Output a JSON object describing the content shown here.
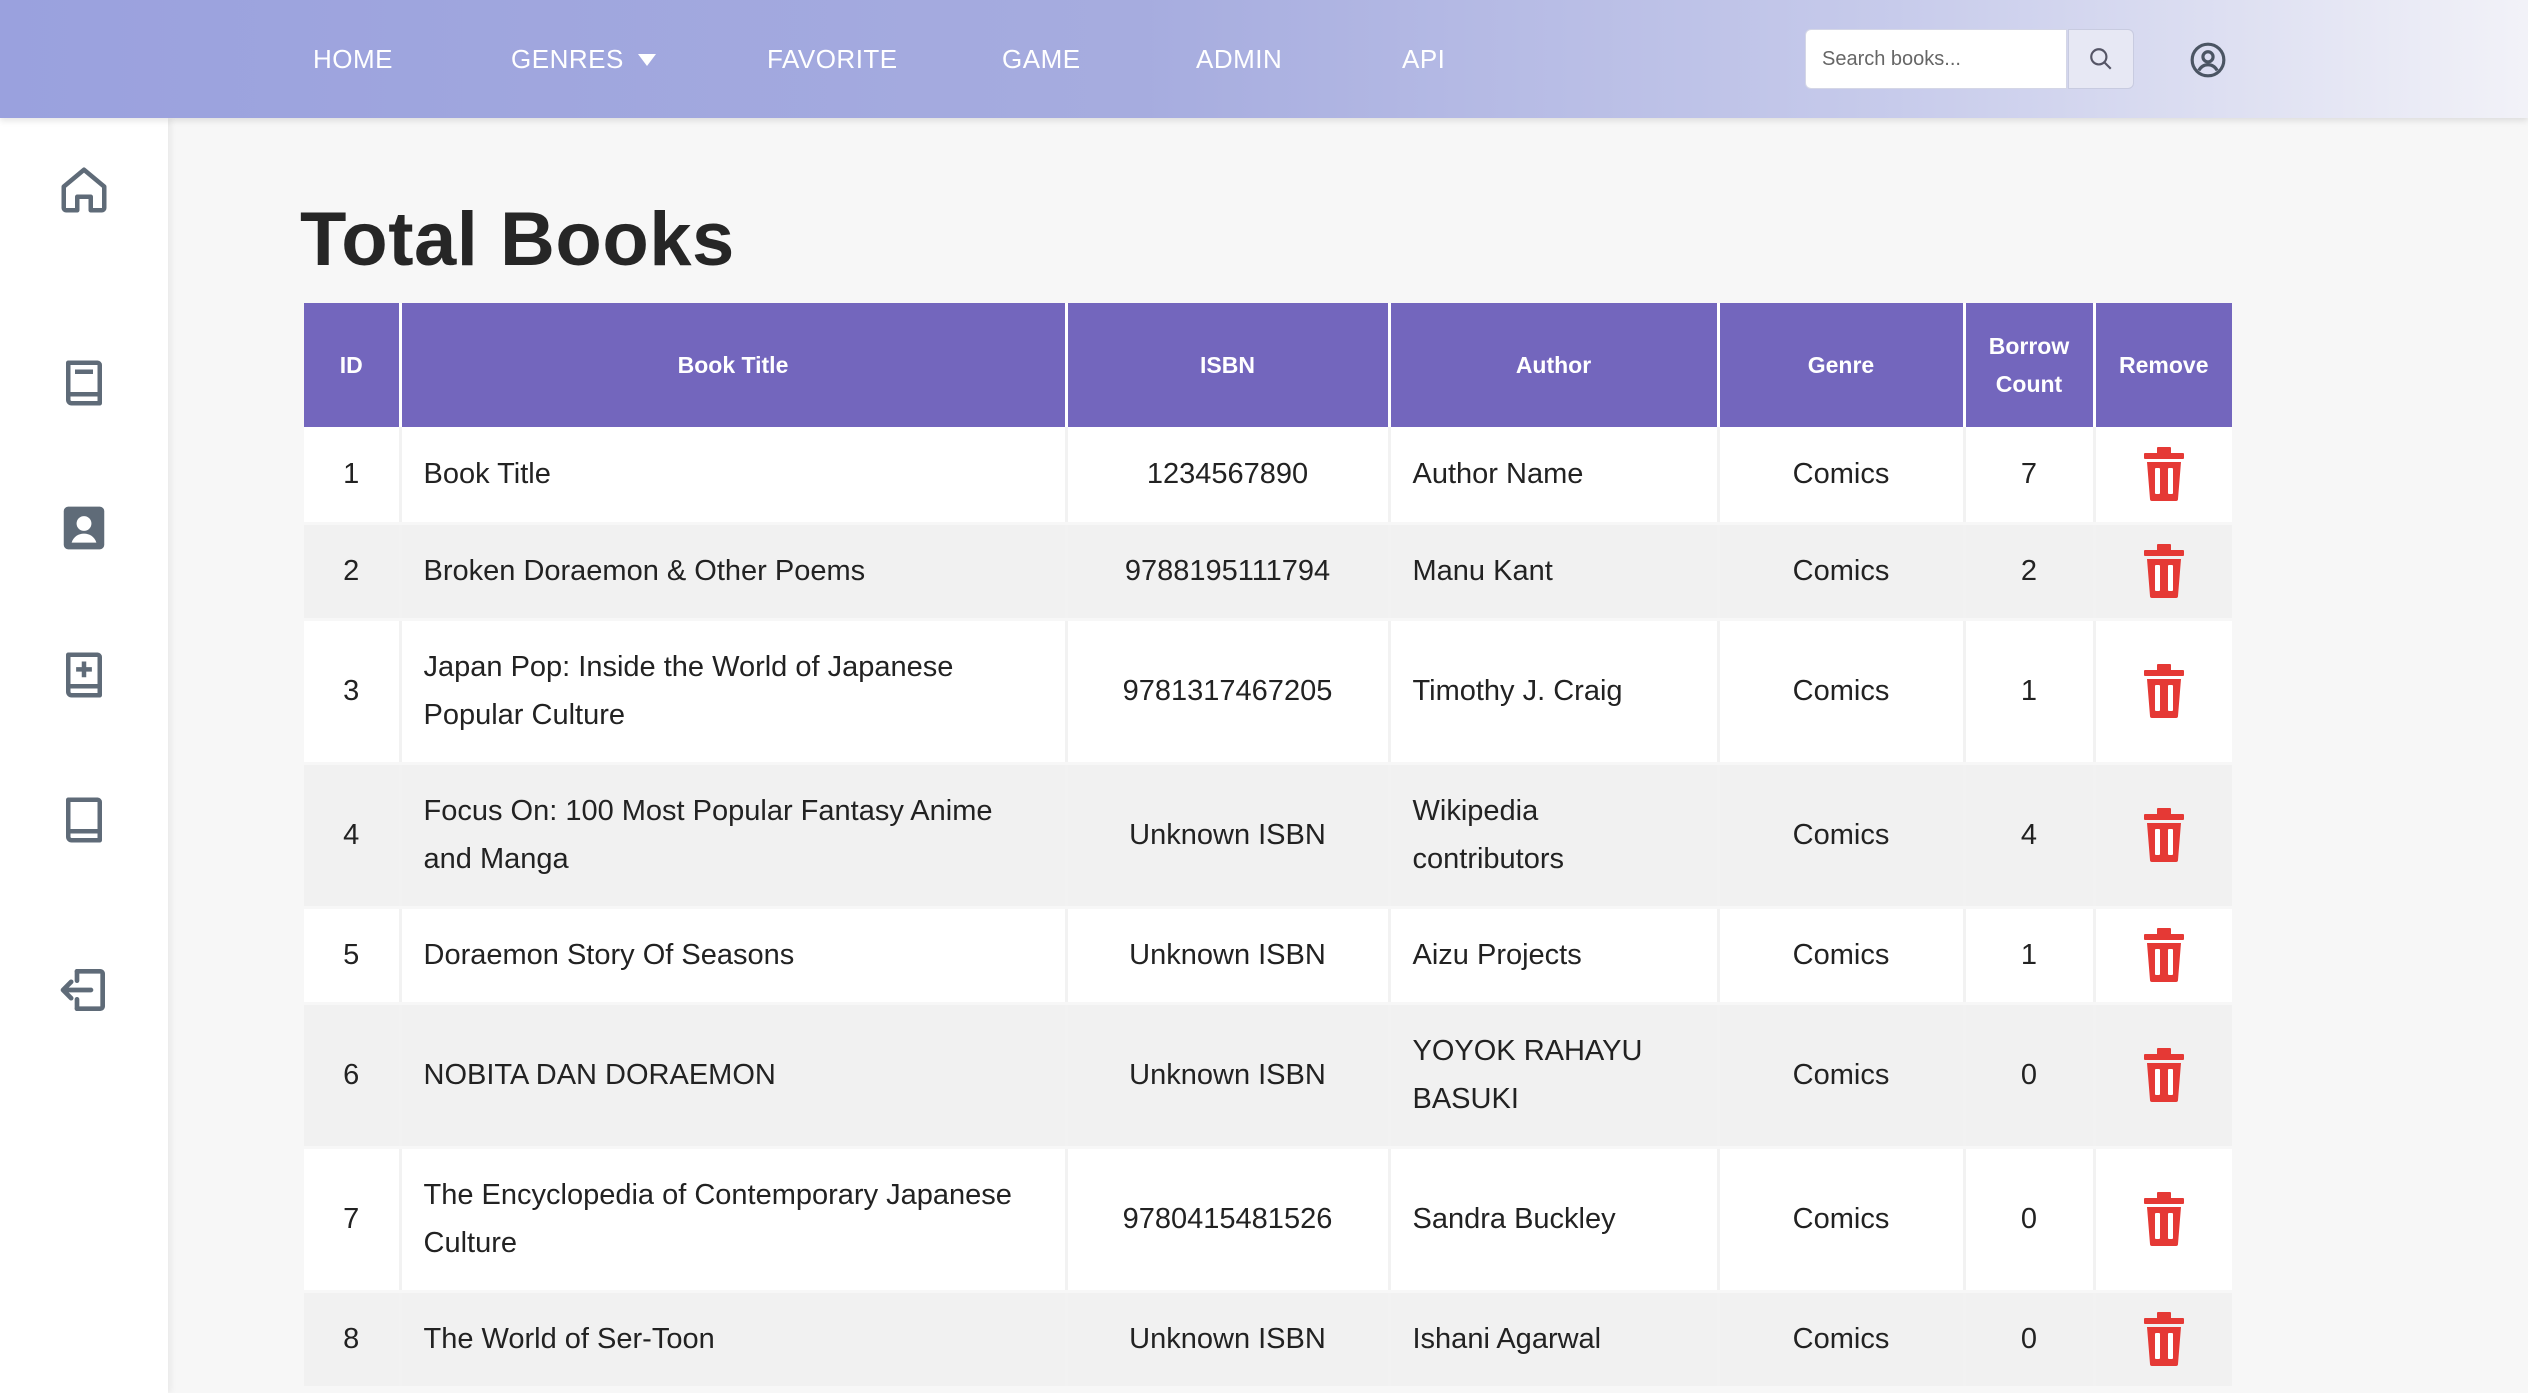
{
  "nav": {
    "home": "HOME",
    "genres": "GENRES",
    "favorite": "FAVORITE",
    "game": "GAME",
    "admin": "ADMIN",
    "api": "API"
  },
  "search": {
    "placeholder": "Search books...",
    "value": ""
  },
  "page_title": "Total Books",
  "table": {
    "headers": {
      "id": "ID",
      "title": "Book Title",
      "isbn": "ISBN",
      "author": "Author",
      "genre": "Genre",
      "borrow_count": "Borrow Count",
      "remove": "Remove"
    },
    "rows": [
      {
        "id": "1",
        "title": "Book Title",
        "isbn": "1234567890",
        "author": "Author Name",
        "genre": "Comics",
        "borrow_count": "7"
      },
      {
        "id": "2",
        "title": "Broken Doraemon & Other Poems",
        "isbn": "9788195111794",
        "author": "Manu Kant",
        "genre": "Comics",
        "borrow_count": "2"
      },
      {
        "id": "3",
        "title": "Japan Pop: Inside the World of Japanese Popular Culture",
        "isbn": "9781317467205",
        "author": "Timothy J. Craig",
        "genre": "Comics",
        "borrow_count": "1"
      },
      {
        "id": "4",
        "title": "Focus On: 100 Most Popular Fantasy Anime and Manga",
        "isbn": "Unknown ISBN",
        "author": "Wikipedia contributors",
        "genre": "Comics",
        "borrow_count": "4"
      },
      {
        "id": "5",
        "title": "Doraemon Story Of Seasons",
        "isbn": "Unknown ISBN",
        "author": "Aizu Projects",
        "genre": "Comics",
        "borrow_count": "1"
      },
      {
        "id": "6",
        "title": "NOBITA DAN DORAEMON",
        "isbn": "Unknown ISBN",
        "author": "YOYOK RAHAYU BASUKI",
        "genre": "Comics",
        "borrow_count": "0"
      },
      {
        "id": "7",
        "title": "The Encyclopedia of Contemporary Japanese Culture",
        "isbn": "9780415481526",
        "author": "Sandra Buckley",
        "genre": "Comics",
        "borrow_count": "0"
      },
      {
        "id": "8",
        "title": "The World of Ser-Toon",
        "isbn": "Unknown ISBN",
        "author": "Ishani Agarwal",
        "genre": "Comics",
        "borrow_count": "0"
      }
    ]
  },
  "sidebar_icons": [
    "home-icon",
    "book-icon",
    "contact-card-icon",
    "add-book-icon",
    "book-icon",
    "logout-icon"
  ],
  "colors": {
    "header_bg": "#7366bd",
    "nav_gradient_start": "#9aa1de",
    "delete_red": "#e53935",
    "icon_gray": "#5f6b78"
  }
}
